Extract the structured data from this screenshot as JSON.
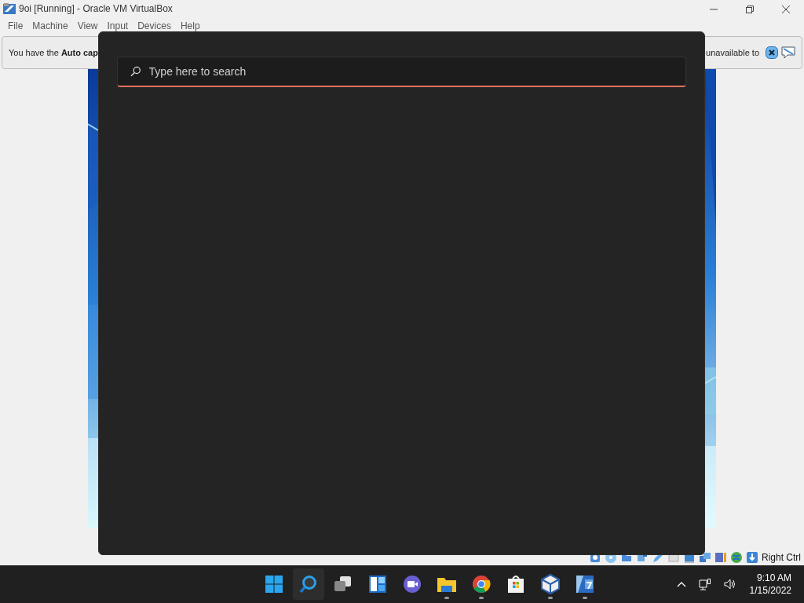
{
  "window": {
    "title": "9oi [Running] - Oracle VM VirtualBox"
  },
  "menu": [
    "File",
    "Machine",
    "View",
    "Input",
    "Devices",
    "Help"
  ],
  "notification": {
    "text_start": "You have the **Auto cap**",
    "text_end": "unavailable to"
  },
  "search": {
    "placeholder": "Type here to search"
  },
  "status_bar": {
    "host_key": "Right Ctrl"
  },
  "taskbar": {
    "apps": [
      {
        "selected": false,
        "running": false
      },
      {
        "selected": true,
        "running": false
      },
      {
        "selected": false,
        "running": false
      },
      {
        "selected": false,
        "running": false
      },
      {
        "selected": false,
        "running": false
      },
      {
        "selected": false,
        "running": true
      },
      {
        "selected": false,
        "running": true
      },
      {
        "selected": false,
        "running": false
      },
      {
        "selected": false,
        "running": true
      },
      {
        "selected": false,
        "running": true
      }
    ],
    "time": "9:10 AM",
    "date": "1/15/2022"
  }
}
